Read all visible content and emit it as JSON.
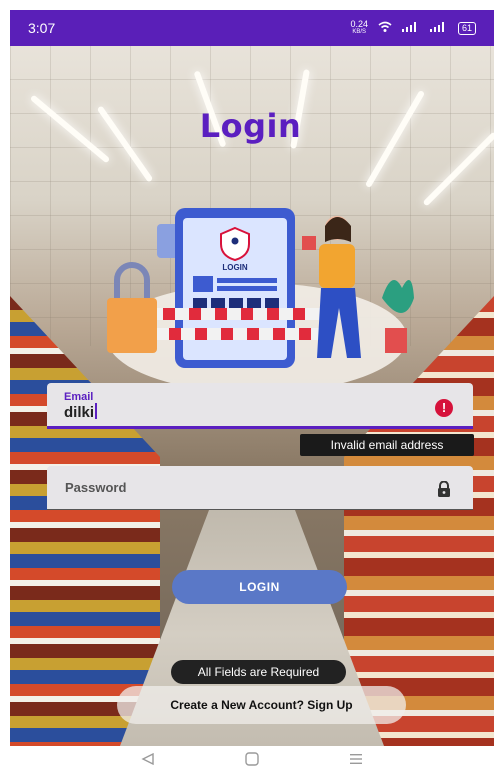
{
  "status_bar": {
    "time": "3:07",
    "data_speed": "0.24",
    "data_unit": "KB/S",
    "battery": "61"
  },
  "screen": {
    "title": "Login",
    "illustration_label": "LOGIN"
  },
  "form": {
    "email": {
      "label": "Email",
      "value": "dilki",
      "error_message": "Invalid email address"
    },
    "password": {
      "placeholder": "Password"
    },
    "login_button": "LOGIN",
    "toast": "All Fields are Required",
    "signup_link": "Create a New Account? Sign Up"
  },
  "colors": {
    "primary": "#5b1fc0",
    "button": "#5a78c7",
    "error": "#d6123b"
  },
  "icons": {
    "email_error": "error-icon",
    "password": "lock-icon",
    "nav_back": "back-icon",
    "nav_home": "home-icon",
    "nav_recents": "menu-icon"
  }
}
